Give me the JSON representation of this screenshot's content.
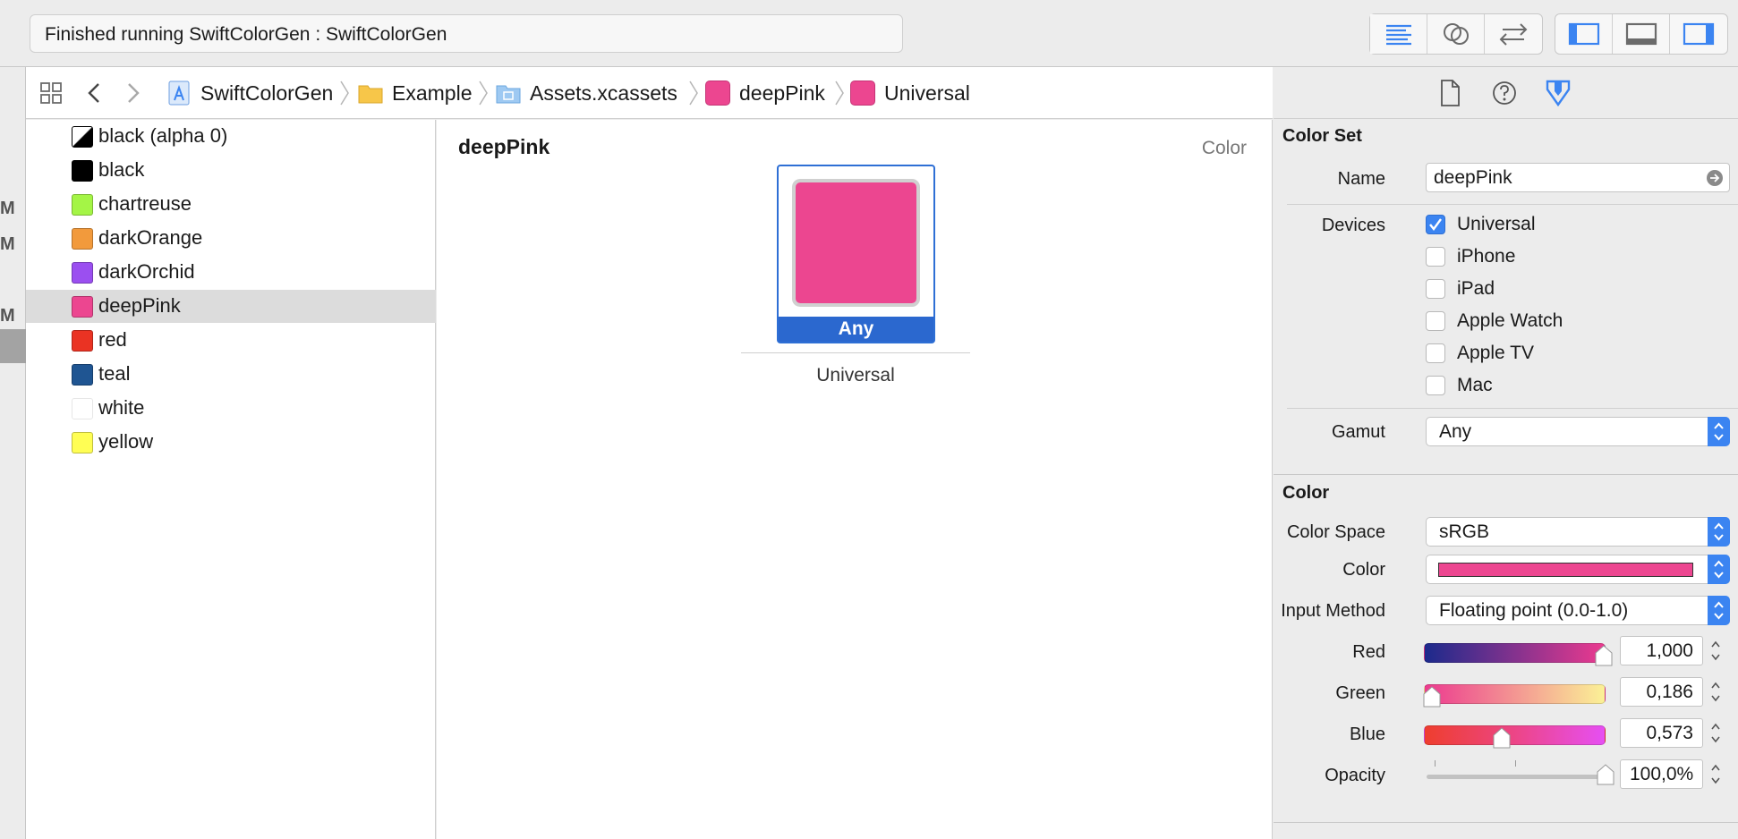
{
  "toolbar": {
    "status_text": "Finished running SwiftColorGen : SwiftColorGen"
  },
  "gutter": {
    "markers": [
      "M",
      "M",
      "M"
    ]
  },
  "jumpbar": {
    "path": [
      "SwiftColorGen",
      "Example",
      "Assets.xcassets",
      "deepPink",
      "Universal"
    ]
  },
  "assets": [
    {
      "name": "black (alpha 0)",
      "color": "#000000"
    },
    {
      "name": "black",
      "color": "#000000"
    },
    {
      "name": "chartreuse",
      "color": "#a4f546"
    },
    {
      "name": "darkOrange",
      "color": "#f29a3c"
    },
    {
      "name": "darkOrchid",
      "color": "#9b4ff0"
    },
    {
      "name": "deepPink",
      "color": "#ec4690",
      "selected": true
    },
    {
      "name": "red",
      "color": "#ea3323"
    },
    {
      "name": "teal",
      "color": "#1f5592"
    },
    {
      "name": "white",
      "color": "#ffffff"
    },
    {
      "name": "yellow",
      "color": "#fffe54"
    }
  ],
  "editor": {
    "title": "deepPink",
    "type_label": "Color",
    "well_label": "Any",
    "group_label": "Universal",
    "color": "#ec4690"
  },
  "inspector": {
    "color_set_title": "Color Set",
    "name_label": "Name",
    "name_value": "deepPink",
    "devices_label": "Devices",
    "devices": [
      {
        "label": "Universal",
        "checked": true
      },
      {
        "label": "iPhone",
        "checked": false
      },
      {
        "label": "iPad",
        "checked": false
      },
      {
        "label": "Apple Watch",
        "checked": false
      },
      {
        "label": "Apple TV",
        "checked": false
      },
      {
        "label": "Mac",
        "checked": false
      }
    ],
    "gamut_label": "Gamut",
    "gamut_value": "Any",
    "color_title": "Color",
    "color_space_label": "Color Space",
    "color_space_value": "sRGB",
    "color_label": "Color",
    "input_method_label": "Input Method",
    "input_method_value": "Floating point (0.0-1.0)",
    "red_label": "Red",
    "red_value": "1,000",
    "green_label": "Green",
    "green_value": "0,186",
    "blue_label": "Blue",
    "blue_value": "0,573",
    "opacity_label": "Opacity",
    "opacity_value": "100,0%",
    "accent": "#3b84f1"
  }
}
